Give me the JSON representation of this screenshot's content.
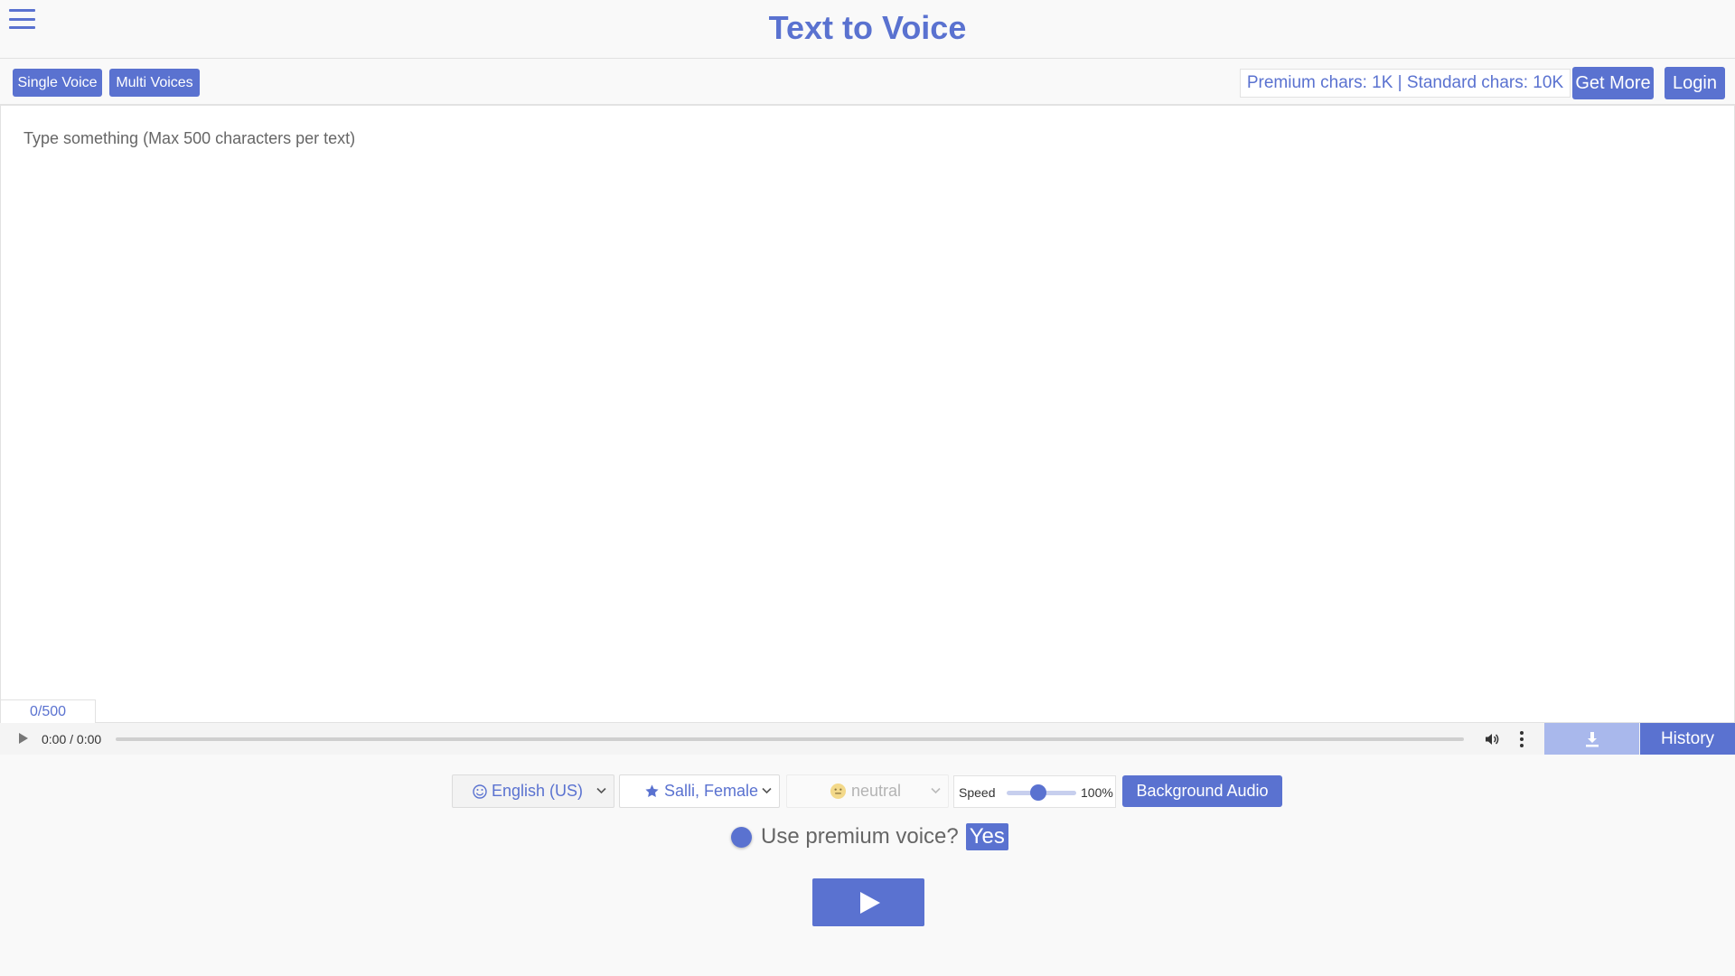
{
  "header": {
    "title": "Text to Voice"
  },
  "toolbar": {
    "tabs": [
      {
        "label": "Single Voice"
      },
      {
        "label": "Multi Voices"
      }
    ],
    "quota": "Premium chars: 1K | Standard chars: 10K",
    "get_more_label": "Get More",
    "login_label": "Login"
  },
  "editor": {
    "placeholder": "Type something (Max 500 characters per text)",
    "value": "",
    "counter": "0/500"
  },
  "player": {
    "time": "0:00 / 0:00",
    "history_label": "History"
  },
  "controls": {
    "language": "English (US)",
    "voice": "Salli, Female",
    "style": "neutral",
    "speed_label": "Speed",
    "speed_value": "100%",
    "background_audio_label": "Background Audio",
    "premium_question": "Use premium voice?",
    "premium_answer": "Yes"
  },
  "icons": {
    "menu": "hamburger-menu-icon",
    "play": "play-icon",
    "volume": "volume-icon",
    "more": "kebab-menu-icon",
    "download": "download-icon",
    "language": "smiley-icon",
    "voice": "star-icon",
    "style": "emoji-face-icon",
    "dropdown": "chevron-down-icon"
  },
  "colors": {
    "accent": "#5a72d0",
    "accent_light": "#a9b8ec",
    "background": "#f9f9f9"
  }
}
